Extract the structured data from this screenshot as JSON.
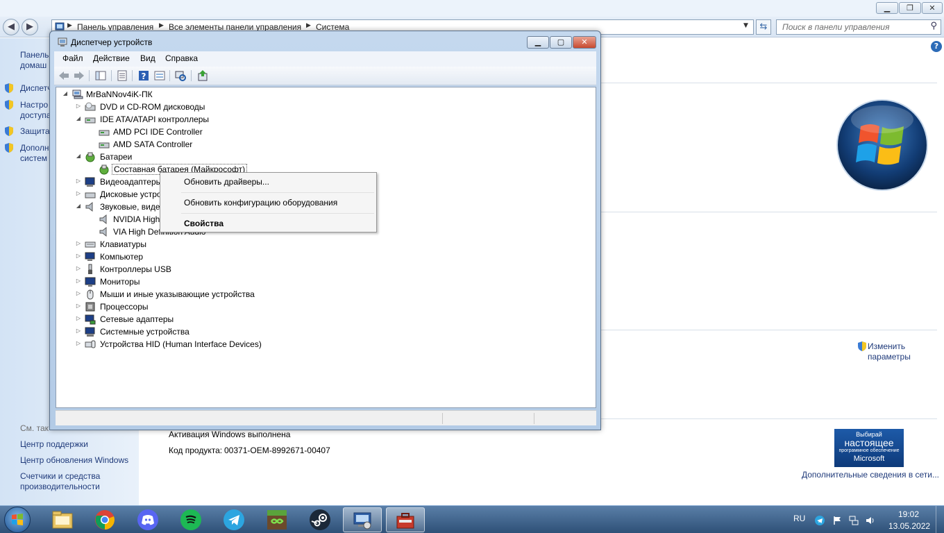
{
  "control_panel": {
    "window_buttons": {
      "minimize": "▁",
      "maximize": "❐",
      "close": "✕"
    },
    "breadcrumbs": [
      "Панель управления",
      "Все элементы панели управления",
      "Система"
    ],
    "search_placeholder": "Поиск в панели управления",
    "left_links": {
      "home_line1": "Панель",
      "home_line2": "домаш",
      "device_manager": "Диспетч",
      "remote_line1": "Настро",
      "remote_line2": "доступа",
      "protection": "Защита",
      "advanced_line1": "Дополн",
      "advanced_line2": "систем"
    },
    "see_also": "См. так",
    "see_also_links": [
      "Центр поддержки",
      "Центр обновления Windows"
    ],
    "perf_line1": "Счетчики и средства",
    "perf_line2": "производительности",
    "change_settings_line1": "Изменить",
    "change_settings_line2": "параметры",
    "activation_status": "Активация Windows выполнена",
    "product_key_label": "Код продукта:",
    "product_key": "00371-OEM-8992671-00407",
    "genuine_badge": {
      "line1": "Выбирай",
      "line2": "настоящее",
      "line3": "программное обеспечение",
      "line4": "Microsoft"
    },
    "more_info_link": "Дополнительные сведения в сети..."
  },
  "device_manager": {
    "title": "Диспетчер устройств",
    "menu": [
      "Файл",
      "Действие",
      "Вид",
      "Справка"
    ],
    "tree": {
      "root": "MrBaNNov4iK-ПК",
      "dvd": "DVD и CD-ROM дисководы",
      "ide": "IDE ATA/ATAPI контроллеры",
      "ide_child1": "AMD PCI IDE Controller",
      "ide_child2": "AMD SATA Controller",
      "batteries": "Батареи",
      "battery_child": "Составная батарея (Майкрософт)",
      "video": "Видеоадаптеры",
      "disk": "Дисковые устро",
      "sound": "Звуковые, видео",
      "sound_child1": "NVIDIA High",
      "sound_child2": "VIA High Definition Audio",
      "keyboards": "Клавиатуры",
      "computer": "Компьютер",
      "usb": "Контроллеры USB",
      "monitors": "Мониторы",
      "mice": "Мыши и иные указывающие устройства",
      "cpu": "Процессоры",
      "network": "Сетевые адаптеры",
      "system": "Системные устройства",
      "hid": "Устройства HID (Human Interface Devices)"
    },
    "context_menu": {
      "update_drivers": "Обновить драйверы...",
      "scan_hardware": "Обновить конфигурацию оборудования",
      "properties": "Свойства"
    }
  },
  "taskbar": {
    "apps": [
      "windows-explorer",
      "google-chrome",
      "discord",
      "spotify",
      "telegram",
      "minecraft-launcher",
      "steam",
      "control-panel-system",
      "device-manager"
    ],
    "language": "RU",
    "time": "19:02",
    "date": "13.05.2022"
  }
}
